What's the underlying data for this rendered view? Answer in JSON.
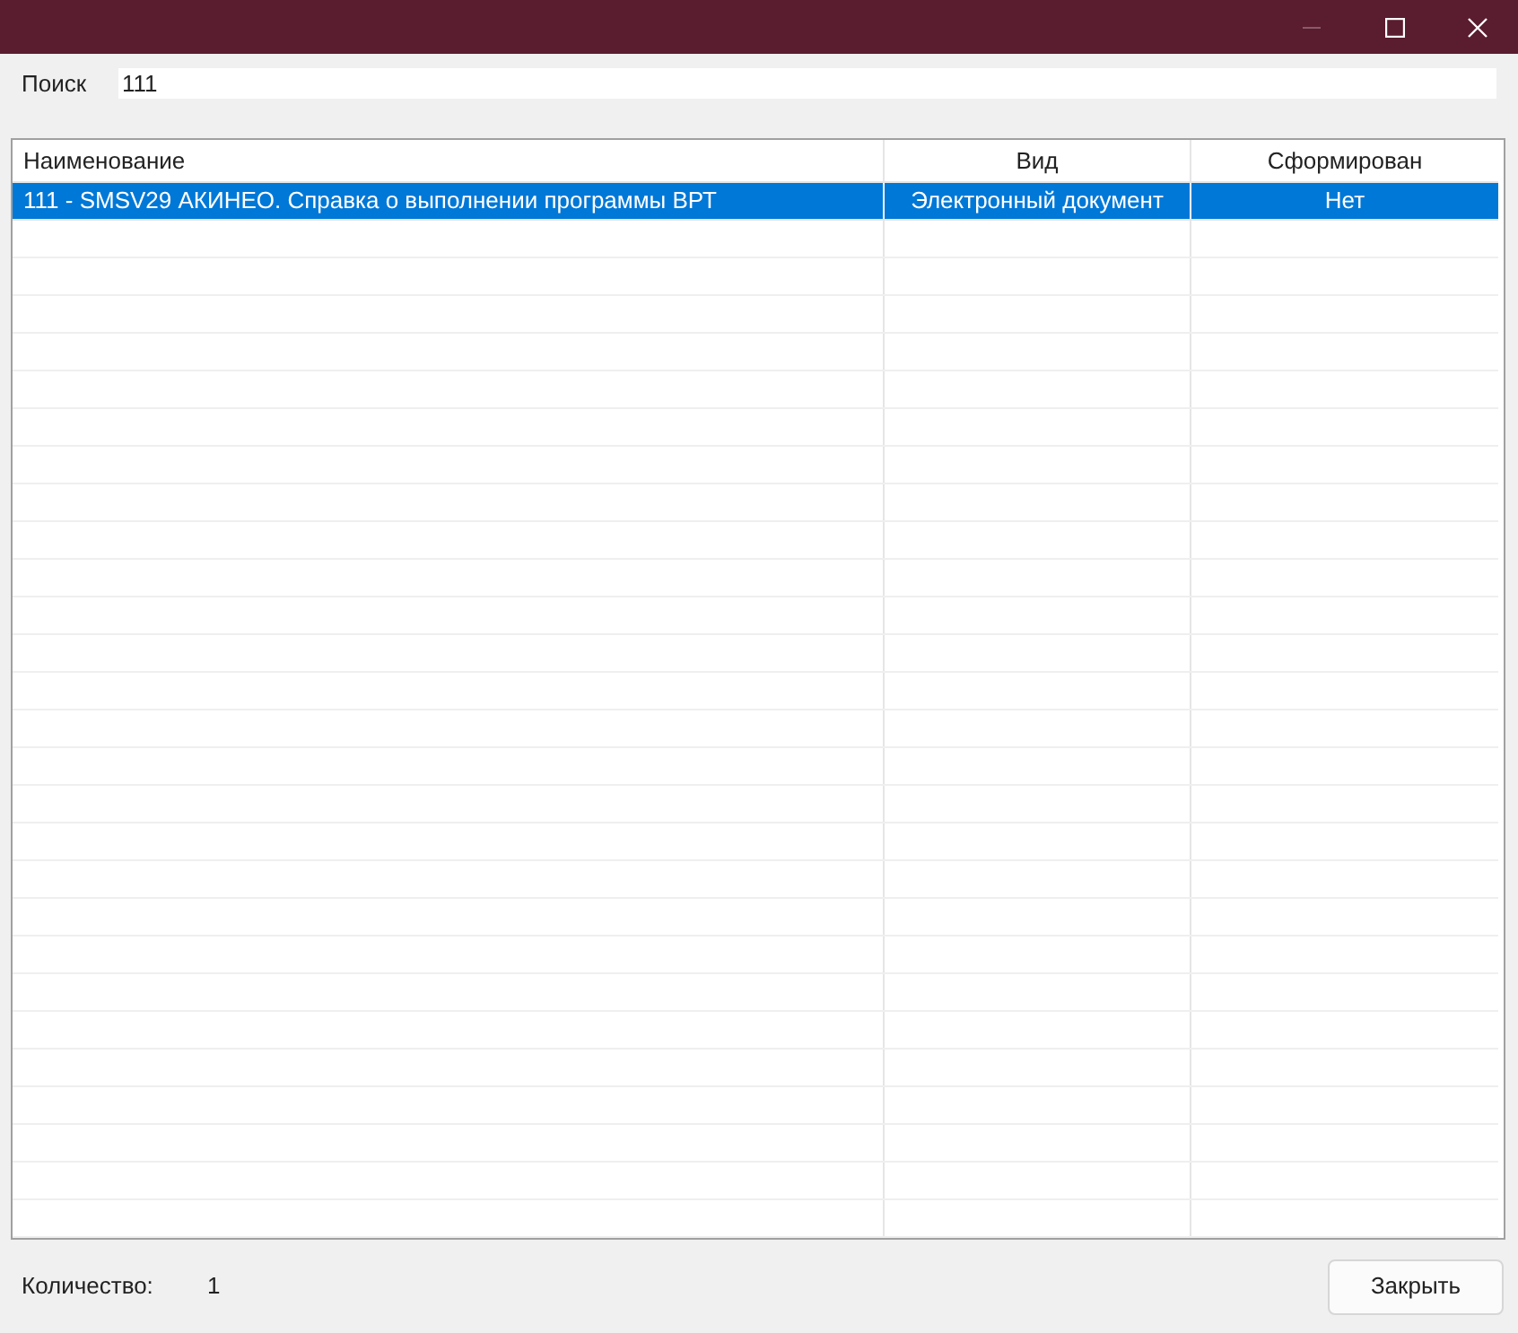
{
  "window": {
    "controls": [
      {
        "kind": "minimize",
        "disabled": true
      },
      {
        "kind": "maximize",
        "disabled": false
      },
      {
        "kind": "close",
        "disabled": false
      }
    ]
  },
  "search": {
    "label": "Поиск",
    "value": "111"
  },
  "table": {
    "columns": [
      "Наименование",
      "Вид",
      "Сформирован"
    ],
    "rows": [
      {
        "cells": [
          "111 - SMSV29 АКИНЕО. Справка о выполнении программы ВРТ",
          "Электронный документ",
          "Нет"
        ],
        "selected": true
      }
    ]
  },
  "footer": {
    "count_label": "Количество:",
    "count": "1",
    "button": "Закрыть"
  }
}
